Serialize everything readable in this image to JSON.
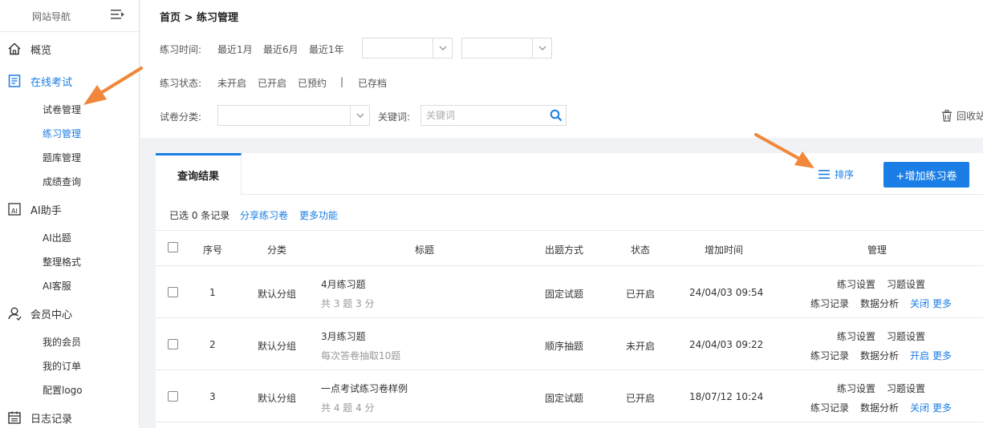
{
  "sidebar": {
    "title": "网站导航",
    "items": [
      {
        "label": "概览",
        "icon": "home-icon"
      },
      {
        "label": "在线考试",
        "icon": "exam-icon"
      },
      {
        "label": "AI助手",
        "icon": "ai-icon"
      },
      {
        "label": "会员中心",
        "icon": "user-icon"
      },
      {
        "label": "日志记录",
        "icon": "calendar-icon"
      }
    ],
    "exam_sub": [
      "试卷管理",
      "练习管理",
      "题库管理",
      "成绩查询"
    ],
    "ai_sub": [
      "AI出题",
      "整理格式",
      "AI客服"
    ],
    "member_sub": [
      "我的会员",
      "我的订单",
      "配置logo"
    ]
  },
  "breadcrumb": "首页 > 练习管理",
  "filters": {
    "time_label": "练习时间:",
    "time_options": [
      "最近1月",
      "最近6月",
      "最近1年"
    ],
    "status_label": "练习状态:",
    "status_options": [
      "未开启",
      "已开启",
      "已预约",
      "|",
      "已存档"
    ],
    "category_label": "试卷分类:",
    "keyword_label": "关键词:",
    "keyword_placeholder": "关键词",
    "recycle": "回收站"
  },
  "results": {
    "tab": "查询结果",
    "sort": "排序",
    "add": "+增加练习卷",
    "selected": "已选 0 条记录",
    "share": "分享练习卷",
    "more": "更多功能"
  },
  "table": {
    "headers": [
      "序号",
      "分类",
      "标题",
      "出题方式",
      "状态",
      "增加时间",
      "管理"
    ],
    "rows": [
      {
        "no": "1",
        "category": "默认分组",
        "title": "4月练习题",
        "sub": "共 3 题 3 分",
        "method": "固定试题",
        "status": "已开启",
        "time": "24/04/03 09:54",
        "toggle": "关闭"
      },
      {
        "no": "2",
        "category": "默认分组",
        "title": "3月练习题",
        "sub": "每次答卷抽取10题",
        "method": "顺序抽题",
        "status": "未开启",
        "time": "24/04/03 09:22",
        "toggle": "开启"
      },
      {
        "no": "3",
        "category": "默认分组",
        "title": "一点考试练习卷样例",
        "sub": "共 4 题 4 分",
        "method": "固定试题",
        "status": "已开启",
        "time": "18/07/12 10:24",
        "toggle": "关闭"
      }
    ],
    "actions": {
      "practice_settings": "练习设置",
      "question_settings": "习题设置",
      "records": "练习记录",
      "analysis": "数据分析",
      "more": "更多"
    }
  },
  "colors": {
    "accent": "#1a7ee6",
    "arrow": "#f0873a"
  }
}
